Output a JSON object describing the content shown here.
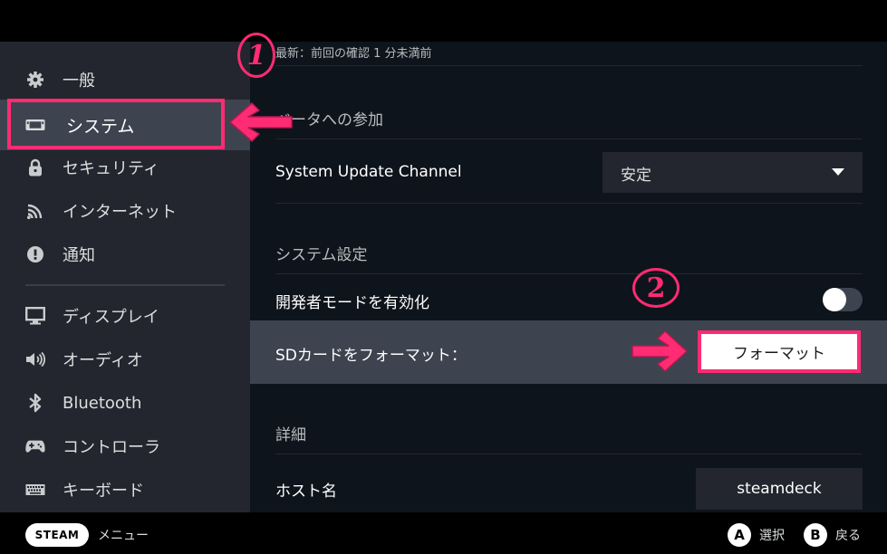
{
  "sidebar": {
    "items": [
      {
        "label": "一般",
        "icon": "gear-icon"
      },
      {
        "label": "システム",
        "icon": "handheld-device-icon",
        "active": true
      },
      {
        "label": "セキュリティ",
        "icon": "lock-icon"
      },
      {
        "label": "インターネット",
        "icon": "wifi-icon"
      },
      {
        "label": "通知",
        "icon": "exclamation-icon"
      },
      {
        "label": "ディスプレイ",
        "icon": "monitor-icon"
      },
      {
        "label": "オーディオ",
        "icon": "speaker-icon"
      },
      {
        "label": "Bluetooth",
        "icon": "bluetooth-icon"
      },
      {
        "label": "コントローラ",
        "icon": "gamepad-icon"
      },
      {
        "label": "キーボード",
        "icon": "keyboard-icon"
      }
    ]
  },
  "main": {
    "update_status": "最新：前回の確認 1 分未満前",
    "beta_section_title": "ベータへの参加",
    "update_channel": {
      "label": "System Update Channel",
      "selected": "安定"
    },
    "system_settings_title": "システム設定",
    "developer_mode": {
      "label": "開発者モードを有効化",
      "enabled": false
    },
    "sd_format": {
      "label": "SDカードをフォーマット：",
      "button_label": "フォーマット"
    },
    "details_title": "詳細",
    "hostname": {
      "label": "ホスト名",
      "value": "steamdeck"
    }
  },
  "bottombar": {
    "steam_label": "STEAM",
    "menu_label": "メニュー",
    "a_button": "A",
    "a_label": "選択",
    "b_button": "B",
    "b_label": "戻る"
  },
  "annotations": {
    "step1": "1",
    "step2": "2",
    "color": "#ff2b73"
  }
}
